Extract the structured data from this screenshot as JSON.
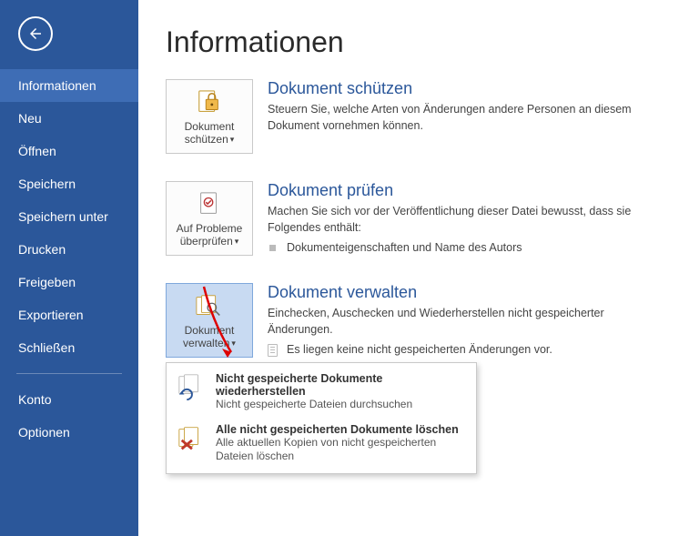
{
  "sidebar": {
    "items": [
      {
        "label": "Informationen",
        "active": true
      },
      {
        "label": "Neu"
      },
      {
        "label": "Öffnen"
      },
      {
        "label": "Speichern"
      },
      {
        "label": "Speichern unter"
      },
      {
        "label": "Drucken"
      },
      {
        "label": "Freigeben"
      },
      {
        "label": "Exportieren"
      },
      {
        "label": "Schließen"
      }
    ],
    "secondary": [
      {
        "label": "Konto"
      },
      {
        "label": "Optionen"
      }
    ]
  },
  "page_title": "Informationen",
  "sections": {
    "protect": {
      "button_label": "Dokument schützen",
      "title": "Dokument schützen",
      "desc": "Steuern Sie, welche Arten von Änderungen andere Personen an diesem Dokument vornehmen können."
    },
    "inspect": {
      "button_label": "Auf Probleme überprüfen",
      "title": "Dokument prüfen",
      "desc": "Machen Sie sich vor der Veröffentlichung dieser Datei bewusst, dass sie Folgendes enthält:",
      "bullet": "Dokumenteigenschaften und Name des Autors"
    },
    "manage": {
      "button_label": "Dokument verwalten",
      "title": "Dokument verwalten",
      "desc": "Einchecken, Auschecken und Wiederherstellen nicht gespeicherter Änderungen.",
      "note": "Es liegen keine nicht gespeicherten Änderungen vor."
    }
  },
  "popup": {
    "recover_title": "Nicht gespeicherte Dokumente wiederherstellen",
    "recover_desc": "Nicht gespeicherte Dateien durchsuchen",
    "delete_title": "Alle nicht gespeicherten Dokumente löschen",
    "delete_desc": "Alle aktuellen Kopien von nicht gespeicherten Dateien löschen"
  }
}
